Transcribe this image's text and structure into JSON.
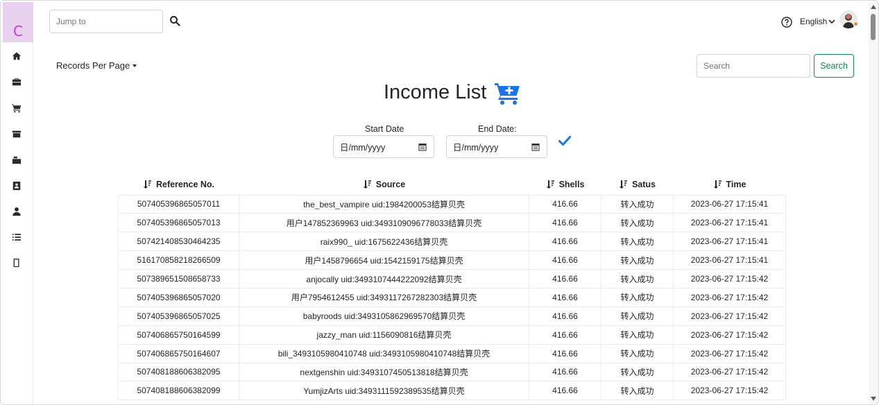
{
  "sidebar": {
    "logo_letter": "C",
    "items": [
      {
        "icon": "home-icon"
      },
      {
        "icon": "briefcase-icon"
      },
      {
        "icon": "cart-icon"
      },
      {
        "icon": "store-icon"
      },
      {
        "icon": "stack-icon"
      },
      {
        "icon": "contact-book-icon"
      },
      {
        "icon": "user-icon"
      },
      {
        "icon": "list-icon"
      },
      {
        "icon": "book-icon"
      }
    ]
  },
  "header": {
    "jump_placeholder": "Jump to",
    "language": "English"
  },
  "toolbar": {
    "records_per_page": "Records Per Page",
    "search_placeholder": "Search",
    "search_button": "Search"
  },
  "page": {
    "title": "Income List"
  },
  "filters": {
    "start_label": "Start Date",
    "start_value": "日/mm/yyyy",
    "end_label": "End Date:",
    "end_value": "日/mm/yyyy"
  },
  "table": {
    "headers": [
      "Reference No.",
      "Source",
      "Shells",
      "Satus",
      "Time"
    ],
    "rows": [
      [
        "507405396865057011",
        "the_best_vampire uid:1984200053结算贝壳",
        "416.66",
        "转入成功",
        "2023-06-27 17:15:41"
      ],
      [
        "507405396865057013",
        "用户147852369963 uid:3493109096778033结算贝壳",
        "416.66",
        "转入成功",
        "2023-06-27 17:15:41"
      ],
      [
        "507421408530464235",
        "raix990_ uid:1675622436结算贝壳",
        "416.66",
        "转入成功",
        "2023-06-27 17:15:41"
      ],
      [
        "516170858218266509",
        "用户1458796654 uid:1542159175结算贝壳",
        "416.66",
        "转入成功",
        "2023-06-27 17:15:41"
      ],
      [
        "507389651508658733",
        "anjocally uid:3493107444222092结算贝壳",
        "416.66",
        "转入成功",
        "2023-06-27 17:15:42"
      ],
      [
        "507405396865057020",
        "用户7954612455 uid:3493117267282303结算贝壳",
        "416.66",
        "转入成功",
        "2023-06-27 17:15:42"
      ],
      [
        "507405396865057025",
        "babyroods uid:3493105862969570结算贝壳",
        "416.66",
        "转入成功",
        "2023-06-27 17:15:42"
      ],
      [
        "507406865750164599",
        "jazzy_man uid:1156090816结算贝壳",
        "416.66",
        "转入成功",
        "2023-06-27 17:15:42"
      ],
      [
        "507406865750164607",
        "bili_3493105980410748 uid:3493105980410748结算贝壳",
        "416.66",
        "转入成功",
        "2023-06-27 17:15:42"
      ],
      [
        "507408188606382095",
        "nextgenshin uid:3493107450513818结算贝壳",
        "416.66",
        "转入成功",
        "2023-06-27 17:15:42"
      ],
      [
        "507408188606382099",
        "YumjizArts uid:3493111592389535结算贝壳",
        "416.66",
        "转入成功",
        "2023-06-27 17:15:42"
      ]
    ]
  },
  "colors": {
    "accent_blue": "#1a73e8",
    "success_green": "#198754",
    "logo_bg": "#e8d2f0",
    "logo_letter": "#c13ad6",
    "status_dot": "#f08a24"
  }
}
